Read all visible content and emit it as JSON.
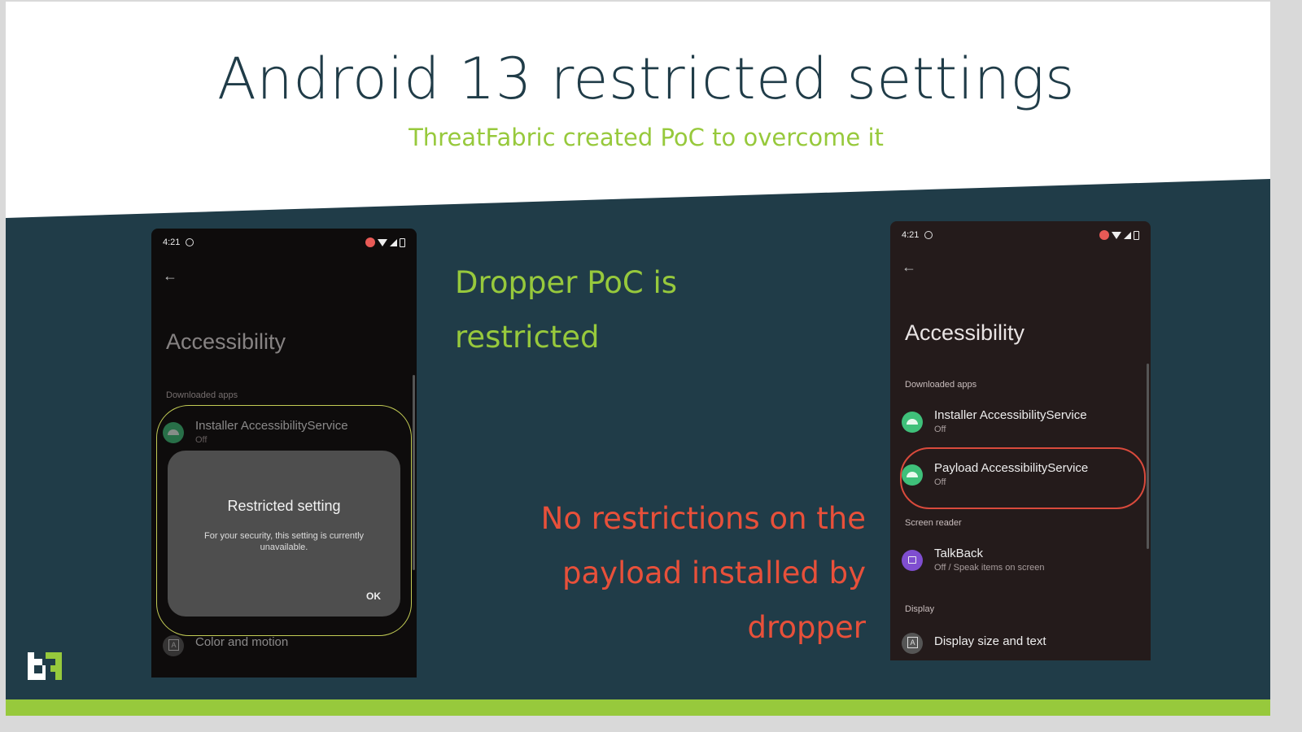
{
  "slide": {
    "title": "Android 13 restricted settings",
    "subtitle": "ThreatFabric created PoC to overcome it",
    "note_restricted": [
      "Dropper PoC is",
      "restricted"
    ],
    "note_unrestricted": [
      "No restrictions on the",
      "payload installed by",
      "dropper"
    ],
    "logo": "threatfabric-logo"
  },
  "colors": {
    "accent_green": "#97c93c",
    "accent_red": "#e8503a",
    "background_dark": "#203c48"
  },
  "phone_left": {
    "time": "4:21",
    "heading": "Accessibility",
    "section": "Downloaded apps",
    "items": [
      {
        "title": "Installer AccessibilityService",
        "subtitle": "Off",
        "icon": "android-icon"
      },
      {
        "title": "Color and motion",
        "icon": "color-motion-icon"
      }
    ],
    "dialog": {
      "title": "Restricted setting",
      "body": "For your security, this setting is currently unavailable.",
      "ok_label": "OK"
    }
  },
  "phone_right": {
    "time": "4:21",
    "heading": "Accessibility",
    "sections": [
      {
        "label": "Downloaded apps"
      },
      {
        "label": "Screen reader"
      },
      {
        "label": "Display"
      }
    ],
    "items": [
      {
        "title": "Installer AccessibilityService",
        "subtitle": "Off",
        "icon": "android-icon"
      },
      {
        "title": "Payload AccessibilityService",
        "subtitle": "Off",
        "icon": "android-icon"
      },
      {
        "title": "TalkBack",
        "subtitle": "Off / Speak items on screen",
        "icon": "talkback-icon"
      },
      {
        "title": "Display size and text",
        "icon": "display-size-icon"
      }
    ]
  }
}
